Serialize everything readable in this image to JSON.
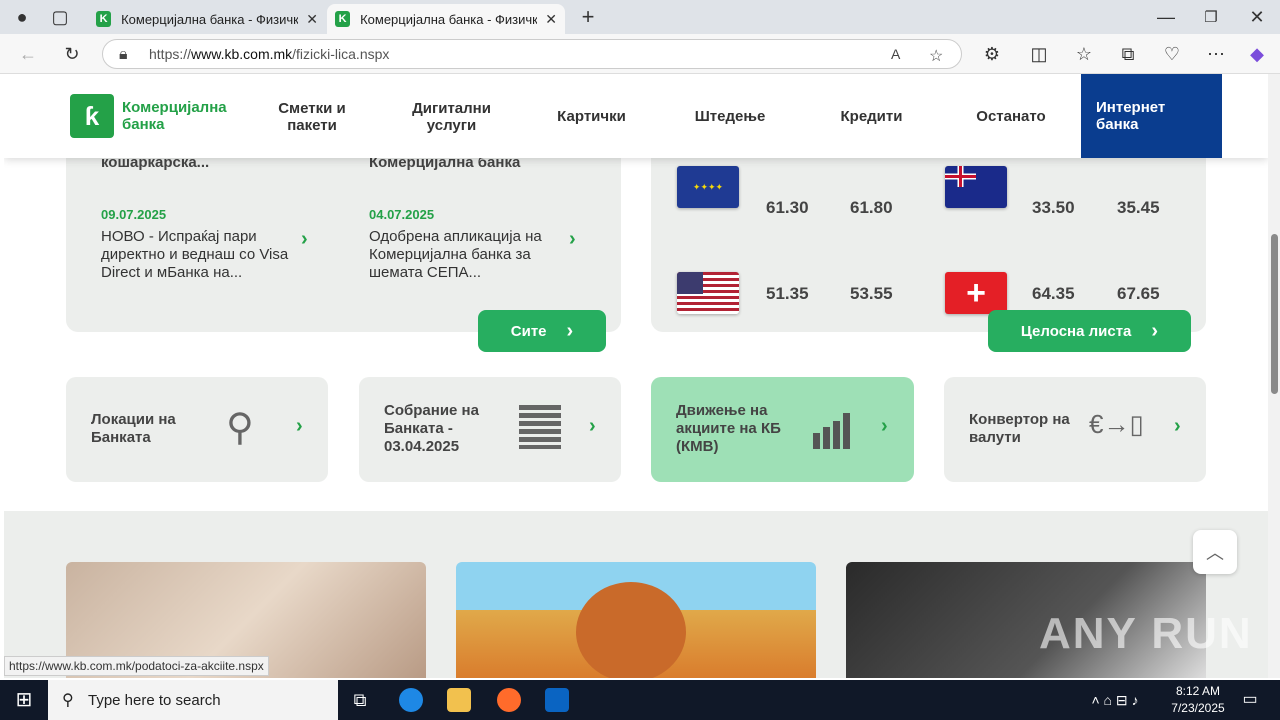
{
  "browser": {
    "tabs": [
      {
        "title": "Комерцијална банка - Физички л"
      },
      {
        "title": "Комерцијална банка - Физички л"
      }
    ],
    "url_prefix": "https://",
    "url_host": "www.kb.com.mk",
    "url_path": "/fizicki-lica.nspx",
    "status_url": "https://www.kb.com.mk/podatoci-za-akciite.nspx"
  },
  "site": {
    "logo": {
      "line1": "Комерцијална",
      "line2": "банка"
    },
    "nav": [
      {
        "l1": "Сметки и",
        "l2": "пакети"
      },
      {
        "l1": "Дигитални",
        "l2": "услуги"
      },
      {
        "l1": "Картички",
        "l2": ""
      },
      {
        "l1": "Штедење",
        "l2": ""
      },
      {
        "l1": "Кредити",
        "l2": ""
      },
      {
        "l1": "Останато",
        "l2": ""
      }
    ],
    "internet_bank": {
      "l1": "Интернет",
      "l2": "банка"
    }
  },
  "news": {
    "partial_top": [
      "кошаркарска...",
      "Комерцијална банка"
    ],
    "items": [
      {
        "date": "09.07.2025",
        "text": "НОВО - Испраќај пари директно и веднаш со Visa Direct и мБанка на..."
      },
      {
        "date": "04.07.2025",
        "text": "Одобрена апликација на Комерцијална банка за шемата СЕПА..."
      }
    ],
    "all_button": "Сите"
  },
  "rates": {
    "rows": [
      {
        "left_buy": "61.30",
        "left_sell": "61.80",
        "right_buy": "33.50",
        "right_sell": "35.45"
      },
      {
        "left_buy": "51.35",
        "left_sell": "53.55",
        "right_buy": "64.35",
        "right_sell": "67.65"
      }
    ],
    "full_list_button": "Целосна листа"
  },
  "tiles": [
    {
      "line1": "Локации на",
      "line2": "Банката",
      "line3": "",
      "icon": "location-pins-icon"
    },
    {
      "line1": "Собрание на",
      "line2": "Банката -",
      "line3": "03.04.2025",
      "icon": "building-icon"
    },
    {
      "line1": "Движење на",
      "line2": "акциите на КБ",
      "line3": "(КМВ)",
      "icon": "bar-chart-icon"
    },
    {
      "line1": "Конвертор на",
      "line2": "валути",
      "line3": "",
      "icon": "currency-convert-icon"
    }
  ],
  "watermark": "ANY RUN",
  "taskbar": {
    "search_placeholder": "Type here to search",
    "time": "8:12 AM",
    "date": "7/23/2025"
  }
}
